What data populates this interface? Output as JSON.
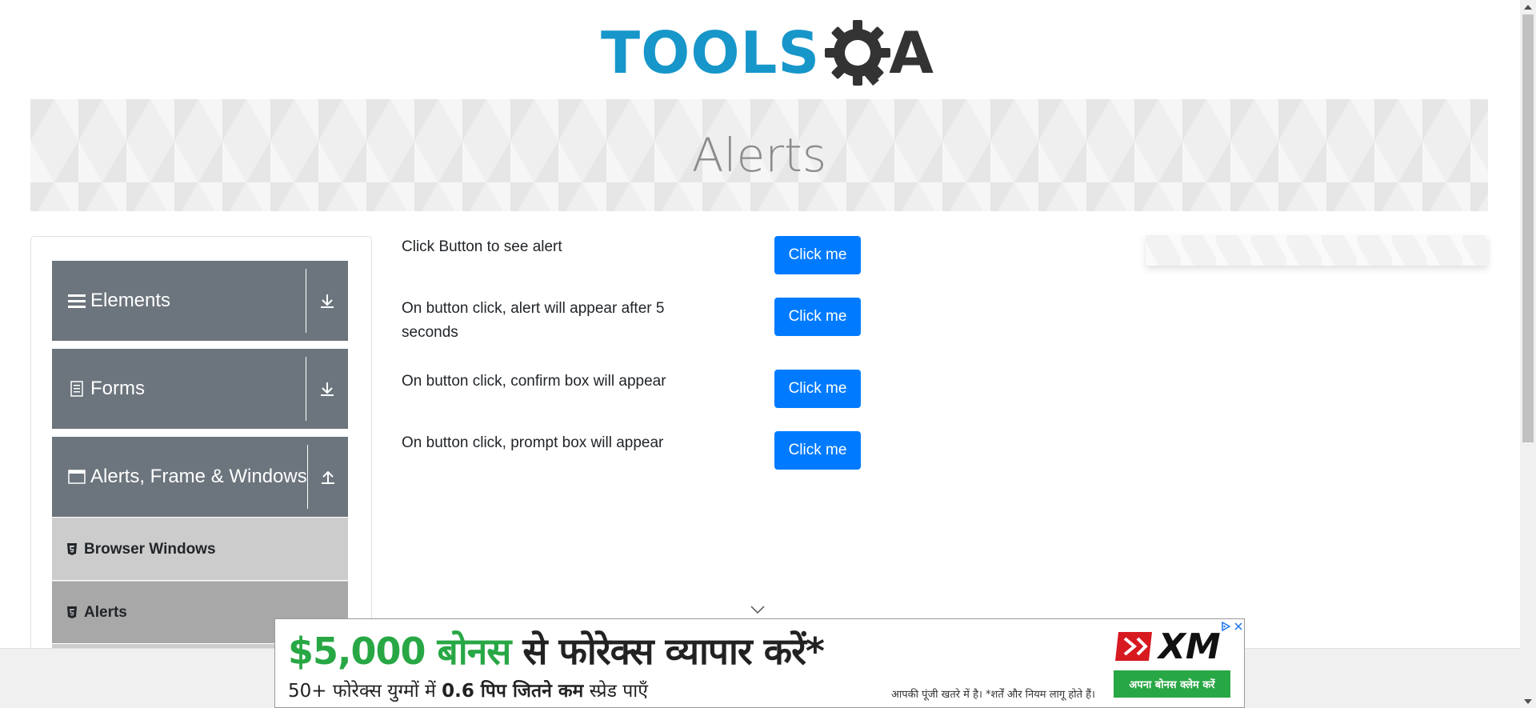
{
  "header": {
    "logo_text_left": "TOOLS",
    "logo_text_right": "A",
    "logo_color": "#1796c9",
    "logo_gear_color": "#333333"
  },
  "banner": {
    "title": "Alerts"
  },
  "sidebar": {
    "groups": [
      {
        "label": "Elements",
        "icon": "menu-bars-icon",
        "state": "collapsed",
        "arrow": "download-arrow-icon"
      },
      {
        "label": "Forms",
        "icon": "document-icon",
        "state": "collapsed",
        "arrow": "download-arrow-icon"
      },
      {
        "label": "Alerts, Frame & Windows",
        "icon": "window-icon",
        "state": "expanded",
        "arrow": "upload-arrow-icon"
      }
    ],
    "items": [
      {
        "label": "Browser Windows",
        "icon": "html5-icon",
        "active": false
      },
      {
        "label": "Alerts",
        "icon": "html5-icon",
        "active": true
      }
    ],
    "group_color": "#6c757d"
  },
  "main": {
    "rows": [
      {
        "label": "Click Button to see alert",
        "button": "Click me"
      },
      {
        "label": "On button click, alert will appear after 5 seconds",
        "button": "Click me"
      },
      {
        "label": "On button click, confirm box will appear",
        "button": "Click me"
      },
      {
        "label": "On button click, prompt box will appear",
        "button": "Click me"
      }
    ],
    "button_color": "#007bff"
  },
  "ad_bottom": {
    "headline_amount": "$5,000",
    "headline_green": "बोनस",
    "headline_rest": "से फोरेक्स व्यापार करें*",
    "sub_prefix": "50+ फोरेक्स युग्मों में",
    "sub_bold": "0.6 पिप जितने कम",
    "sub_suffix": "स्प्रेड पाएँ",
    "disclaimer": "आपकी पूंजी खतरे में है। *शर्तें और नियम लागू होते हैं।",
    "cta": "अपना बोनस क्लेम करें",
    "brand": "XM",
    "accent": "#28a745"
  }
}
